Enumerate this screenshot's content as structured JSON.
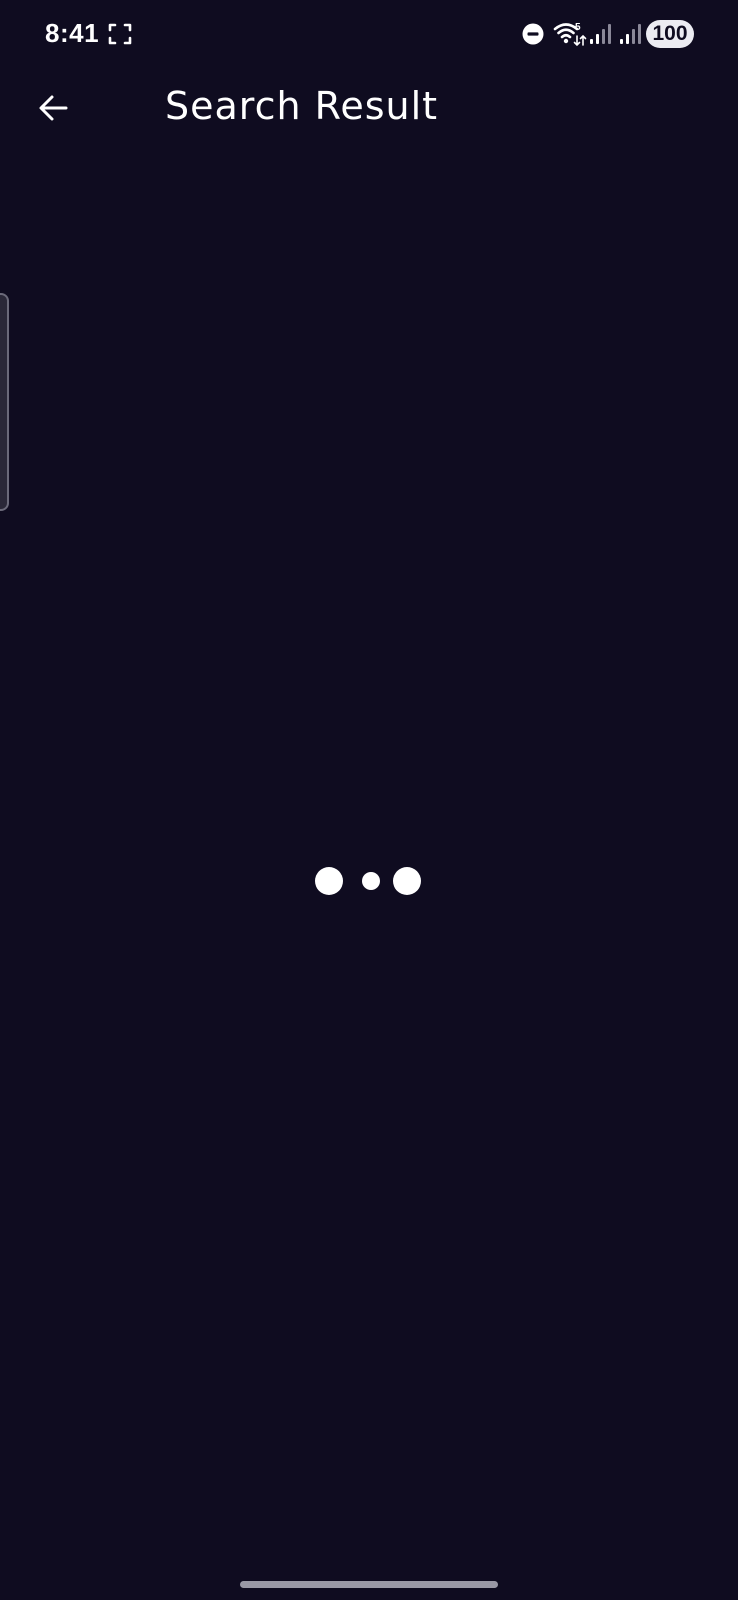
{
  "status_bar": {
    "time": "8:41",
    "battery": "100",
    "icons": [
      "screenshot-icon",
      "do-not-disturb-icon",
      "wifi-icon",
      "signal-icon",
      "signal-icon"
    ]
  },
  "app_bar": {
    "back_icon": "arrow-left-icon",
    "title": "Search Result"
  },
  "content": {
    "state": "loading",
    "indicator": "three-dot-loader"
  },
  "colors": {
    "background": "#0f0c20",
    "text": "#ffffff",
    "battery_badge": "#ececf2",
    "home_indicator": "#9a99a6"
  }
}
